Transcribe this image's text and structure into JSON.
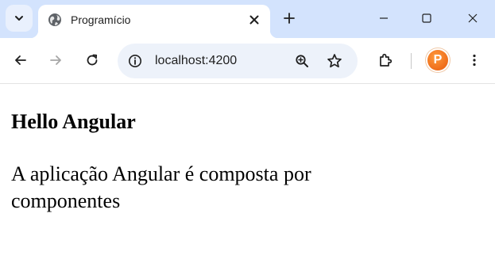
{
  "browser": {
    "tab": {
      "title": "Programício",
      "favicon": "globe-icon"
    },
    "toolbar": {
      "url": "localhost:4200",
      "profile_initial": "P"
    },
    "icons": {
      "tab_search": "chevron-down-icon",
      "close_tab": "close-icon",
      "new_tab": "plus-icon",
      "minimize": "minimize-icon",
      "maximize": "maximize-icon",
      "close_window": "close-icon",
      "back": "back-arrow-icon",
      "forward": "forward-arrow-icon",
      "reload": "reload-icon",
      "site_info": "site-info-icon",
      "zoom": "zoom-icon",
      "bookmark": "star-icon",
      "extensions": "puzzle-icon",
      "menu": "kebab-menu-icon"
    },
    "colors": {
      "tabstrip_bg": "#d3e3fd",
      "omnibox_bg": "#edf2fa",
      "avatar": "#e85a0c"
    }
  },
  "page": {
    "heading": "Hello Angular",
    "paragraph": "A aplicação Angular é composta por componentes"
  }
}
